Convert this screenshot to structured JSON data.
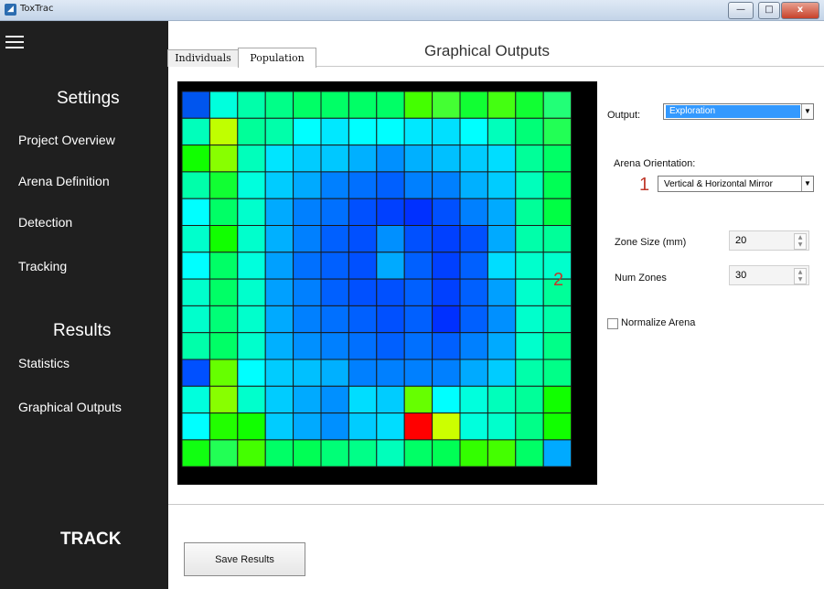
{
  "window": {
    "title": "ToxTrac",
    "minimize_glyph": "—",
    "maximize_glyph": "□",
    "close_glyph": "x"
  },
  "sidebar": {
    "settings_heading": "Settings",
    "settings_items": [
      "Project Overview",
      "Arena Definition",
      "Detection",
      "Tracking"
    ],
    "results_heading": "Results",
    "results_items": [
      "Statistics",
      "Graphical Outputs"
    ],
    "track_label": "TRACK"
  },
  "main": {
    "tabs": [
      {
        "label": "Individuals",
        "active": false
      },
      {
        "label": "Population",
        "active": true
      }
    ],
    "title": "Graphical Outputs",
    "output": {
      "label": "Output:",
      "value": "Exploration"
    },
    "arena_orientation": {
      "label": "Arena Orientation:",
      "value": "Vertical & Horizontal Mirror"
    },
    "zone_size": {
      "label": "Zone Size (mm)",
      "value": "20"
    },
    "num_zones": {
      "label": "Num Zones",
      "value": "30"
    },
    "normalize": {
      "label": "Normalize Arena",
      "checked": false
    },
    "annotation_1": "1",
    "annotation_2": "2",
    "save_button": "Save Results"
  },
  "heatmap": {
    "grid": [
      [
        "#0055ee",
        "#00ffdd",
        "#00ffaa",
        "#00ff88",
        "#00ff66",
        "#00ff66",
        "#00ff66",
        "#00ff66",
        "#44ff00",
        "#44ff33",
        "#11ff33",
        "#44ff11",
        "#11ff33",
        "#22ff77"
      ],
      [
        "#00ffbb",
        "#c0ff00",
        "#00ff99",
        "#00ffaa",
        "#00ffff",
        "#00e8ff",
        "#00ffff",
        "#00ffff",
        "#00e8ff",
        "#00e0ff",
        "#00ffff",
        "#00ffbb",
        "#00ff77",
        "#22ff55"
      ],
      [
        "#11ff00",
        "#88ff00",
        "#00ffbb",
        "#00e5ff",
        "#00ccff",
        "#00c8ff",
        "#00b0ff",
        "#0090ff",
        "#00b0ff",
        "#00c0ff",
        "#00ccff",
        "#00ddff",
        "#00ff99",
        "#00ff66"
      ],
      [
        "#00ffaa",
        "#11ff33",
        "#00ffdd",
        "#00ccff",
        "#00aaff",
        "#0080ff",
        "#0070ff",
        "#0060ff",
        "#0080ff",
        "#0080ff",
        "#00b0ff",
        "#00ccff",
        "#00ffbb",
        "#00ff55"
      ],
      [
        "#00ffff",
        "#00ff66",
        "#00ffcc",
        "#00aaff",
        "#0080ff",
        "#0070ff",
        "#0050ff",
        "#0040ff",
        "#0030ff",
        "#0050ff",
        "#0080ff",
        "#00aaff",
        "#00ff99",
        "#00ff44"
      ],
      [
        "#00ffcc",
        "#11ff00",
        "#00ffcc",
        "#00b0ff",
        "#0080ff",
        "#0060ff",
        "#0050ff",
        "#0090ff",
        "#0050ff",
        "#0040ff",
        "#0050ff",
        "#00aaff",
        "#00ffaa",
        "#00ff99"
      ],
      [
        "#00ffff",
        "#00ff66",
        "#00ffdd",
        "#00a0ff",
        "#0070ff",
        "#0060ff",
        "#0050ff",
        "#00aaff",
        "#0060ff",
        "#0040ff",
        "#0060ff",
        "#00ddff",
        "#00ffcc",
        "#00ffcc"
      ],
      [
        "#00ffcc",
        "#00ff66",
        "#00ffcc",
        "#00a0ff",
        "#0080ff",
        "#0060ff",
        "#0050ff",
        "#0050ff",
        "#0060ff",
        "#0040ff",
        "#0060ff",
        "#00a0ff",
        "#00ffcc",
        "#00ff99"
      ],
      [
        "#00ffcc",
        "#00ff77",
        "#00ffcc",
        "#00aaff",
        "#0080ff",
        "#0070ff",
        "#0060ff",
        "#0050ff",
        "#0060ff",
        "#0030ff",
        "#0060ff",
        "#0090ff",
        "#00ffcc",
        "#00ffaa"
      ],
      [
        "#00ffaa",
        "#00ff66",
        "#00ffcc",
        "#00b0ff",
        "#0090ff",
        "#0080ff",
        "#0070ff",
        "#0060ff",
        "#0070ff",
        "#0060ff",
        "#0080ff",
        "#00aaff",
        "#00ffcc",
        "#00ff88"
      ],
      [
        "#0050ff",
        "#66ff00",
        "#00ffff",
        "#00ccff",
        "#00c0ff",
        "#00b0ff",
        "#0080ff",
        "#0080ff",
        "#0080ff",
        "#0080ff",
        "#00aaff",
        "#00ccff",
        "#00ffaa",
        "#00ff88"
      ],
      [
        "#00ffdd",
        "#88ff00",
        "#00ffcc",
        "#00ccff",
        "#00aaff",
        "#0090ff",
        "#00ddff",
        "#00ccff",
        "#66ff00",
        "#00ffff",
        "#00ffdd",
        "#00ffbb",
        "#00ff99",
        "#11ff00"
      ],
      [
        "#00ffff",
        "#22ff00",
        "#11ff00",
        "#00ccff",
        "#00aaff",
        "#0090ff",
        "#00ccff",
        "#00ddff",
        "#ff0000",
        "#ccff00",
        "#00ffdd",
        "#00ffcc",
        "#00ff88",
        "#11ff00"
      ],
      [
        "#11ff11",
        "#22ff55",
        "#44ff00",
        "#00ff66",
        "#00ff55",
        "#00ff77",
        "#00ff88",
        "#00ffbb",
        "#00ff66",
        "#00ff55",
        "#33ff00",
        "#44ff00",
        "#00ff66",
        "#00aaff"
      ]
    ]
  }
}
